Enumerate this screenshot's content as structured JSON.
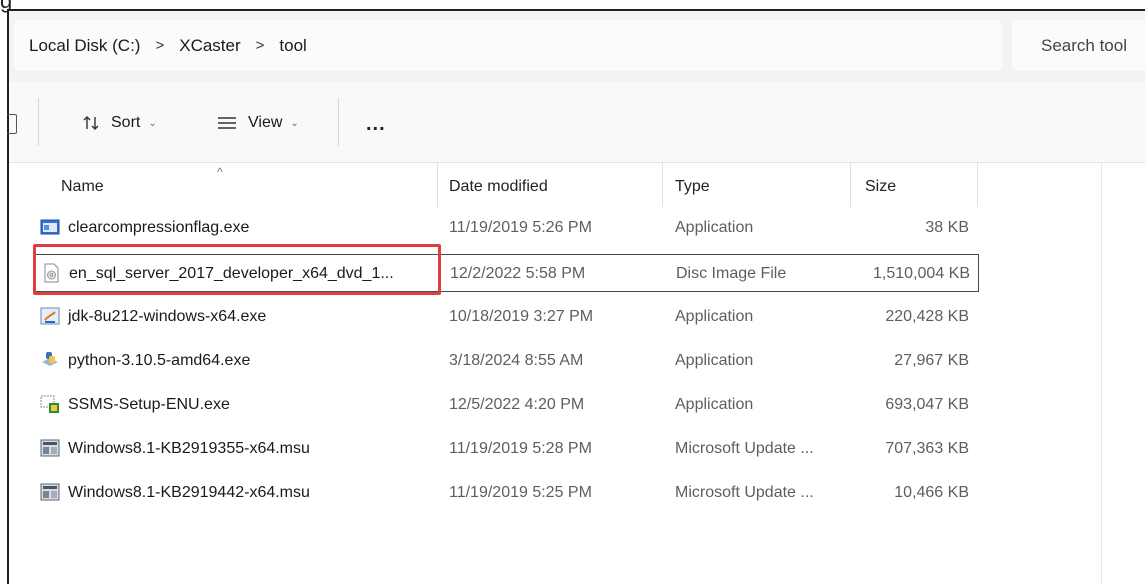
{
  "caption": "g",
  "breadcrumb": {
    "items": [
      "Local Disk (C:)",
      "XCaster",
      "tool"
    ],
    "separator": ">"
  },
  "search": {
    "placeholder": "Search tool"
  },
  "toolbar": {
    "sort_label": "Sort",
    "view_label": "View",
    "more_label": "..."
  },
  "columns": {
    "name": "Name",
    "date": "Date modified",
    "type": "Type",
    "size": "Size"
  },
  "files": [
    {
      "name": "clearcompressionflag.exe",
      "date": "11/19/2019 5:26 PM",
      "type": "Application",
      "size": "38 KB",
      "icon": "app-window-icon"
    },
    {
      "name": "en_sql_server_2017_developer_x64_dvd_1...",
      "date": "12/2/2022 5:58 PM",
      "type": "Disc Image File",
      "size": "1,510,004 KB",
      "icon": "disc-image-icon"
    },
    {
      "name": "jdk-8u212-windows-x64.exe",
      "date": "10/18/2019 3:27 PM",
      "type": "Application",
      "size": "220,428 KB",
      "icon": "java-installer-icon"
    },
    {
      "name": "python-3.10.5-amd64.exe",
      "date": "3/18/2024 8:55 AM",
      "type": "Application",
      "size": "27,967 KB",
      "icon": "python-installer-icon"
    },
    {
      "name": "SSMS-Setup-ENU.exe",
      "date": "12/5/2022 4:20 PM",
      "type": "Application",
      "size": "693,047 KB",
      "icon": "setup-installer-icon"
    },
    {
      "name": "Windows8.1-KB2919355-x64.msu",
      "date": "11/19/2019 5:28 PM",
      "type": "Microsoft Update ...",
      "size": "707,363 KB",
      "icon": "update-package-icon"
    },
    {
      "name": "Windows8.1-KB2919442-x64.msu",
      "date": "11/19/2019 5:25 PM",
      "type": "Microsoft Update ...",
      "size": "10,466 KB",
      "icon": "update-package-icon"
    }
  ],
  "colors": {
    "highlight": "#e03e3e",
    "address_bg": "#f3f3f3",
    "toolbar_bg": "#f9f9f9"
  }
}
